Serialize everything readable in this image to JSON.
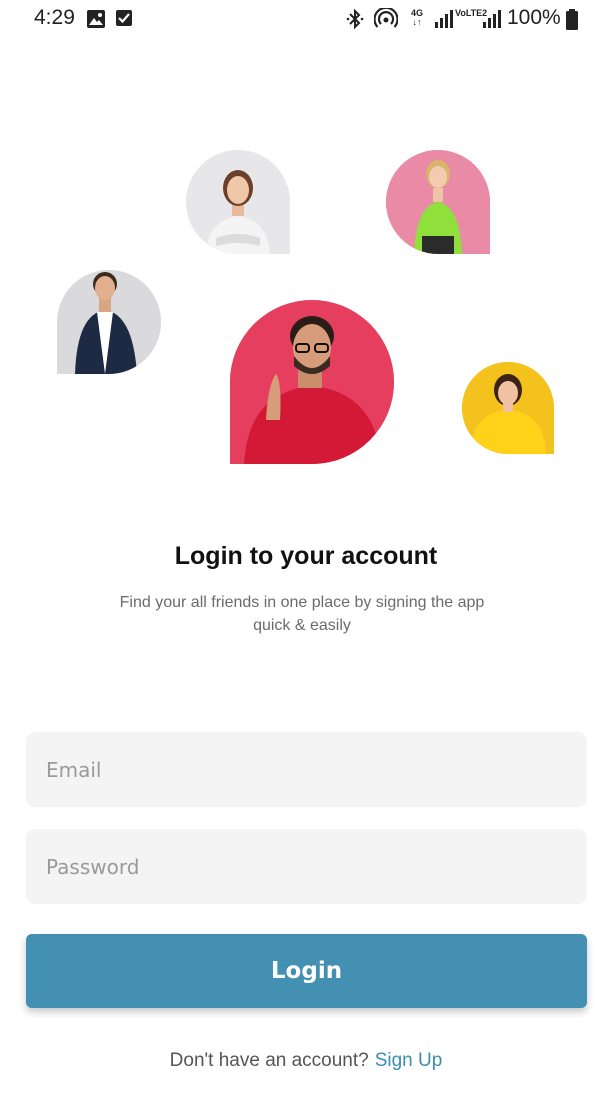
{
  "status_bar": {
    "time": "4:29",
    "network_type": "4G",
    "volte_label": "VoLTE2",
    "battery_text": "100%",
    "icons": [
      "gallery-icon",
      "check-icon",
      "bluetooth-icon",
      "hotspot-icon",
      "signal-icon",
      "signal-icon",
      "battery-icon"
    ]
  },
  "avatars": [
    {
      "name": "woman-white-sweater",
      "bg": "#e7e7e9"
    },
    {
      "name": "woman-green-top",
      "bg": "#e98ba6"
    },
    {
      "name": "man-dark-suit",
      "bg": "#dadadc"
    },
    {
      "name": "man-red-sweater",
      "bg": "#e63e5f"
    },
    {
      "name": "woman-yellow-sweater",
      "bg": "#f3c21d"
    }
  ],
  "login": {
    "title": "Login to your account",
    "subtitle": "Find your all friends in one place by signing the app quick & easily",
    "email_placeholder": "Email",
    "password_placeholder": "Password",
    "button_label": "Login",
    "signup_prompt": "Don't have an account?",
    "signup_link": "Sign Up"
  },
  "colors": {
    "accent": "#4390b3",
    "link": "#3d8eae",
    "input_bg": "#f4f4f4"
  }
}
